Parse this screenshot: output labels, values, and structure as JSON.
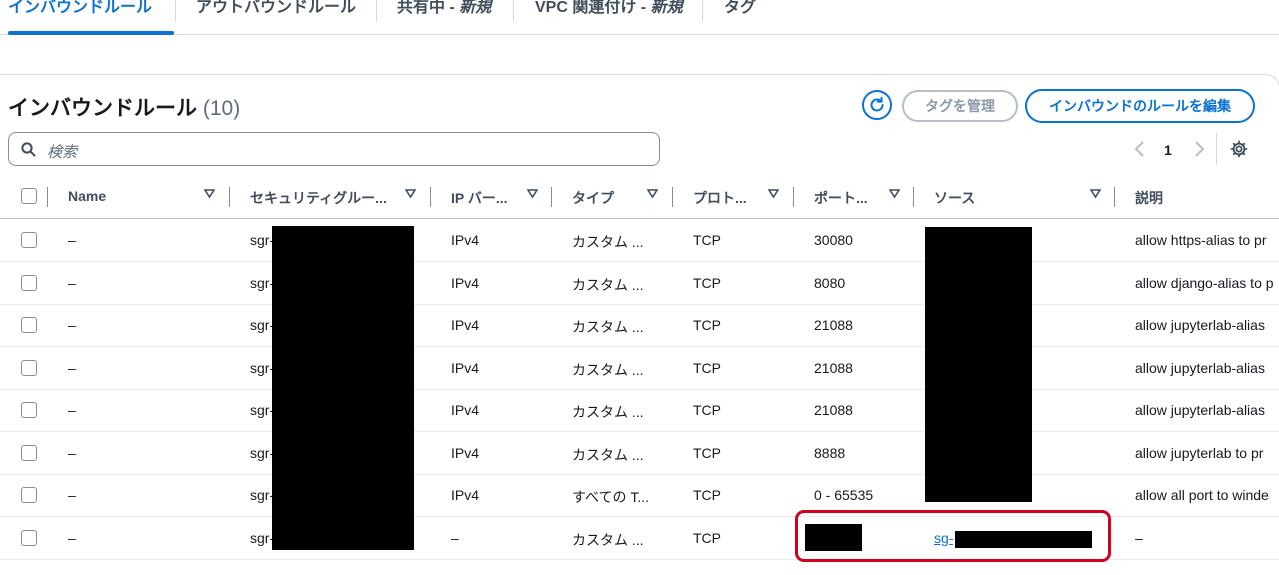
{
  "tabs": [
    {
      "label": "インバウンドルール",
      "active": true
    },
    {
      "label": "アウトバウンドルール",
      "active": false
    },
    {
      "label_prefix": "共有中 - ",
      "label_em": "新規",
      "active": false
    },
    {
      "label_prefix": "VPC 関連付け - ",
      "label_em": "新規",
      "active": false
    },
    {
      "label": "タグ",
      "active": false
    }
  ],
  "header": {
    "title": "インバウンドルール",
    "count": "(10)",
    "manage_tags_label": "タグを管理",
    "edit_rules_label": "インバウンドのルールを編集"
  },
  "search": {
    "placeholder": "検索"
  },
  "pagination": {
    "current_page": "1"
  },
  "columns": [
    "Name",
    "セキュリティグルー...",
    "IP バー...",
    "タイプ",
    "プロト...",
    "ポート...",
    "ソース",
    "説明"
  ],
  "rows": [
    {
      "name": "–",
      "sgr": "sgr-",
      "ip": "IPv4",
      "type": "カスタム ...",
      "proto": "TCP",
      "port": "30080",
      "desc": "allow https-alias to pr"
    },
    {
      "name": "–",
      "sgr": "sgr-",
      "ip": "IPv4",
      "type": "カスタム ...",
      "proto": "TCP",
      "port": "8080",
      "desc": "allow django-alias to p"
    },
    {
      "name": "–",
      "sgr": "sgr-",
      "ip": "IPv4",
      "type": "カスタム ...",
      "proto": "TCP",
      "port": "21088",
      "desc": "allow jupyterlab-alias"
    },
    {
      "name": "–",
      "sgr": "sgr-",
      "ip": "IPv4",
      "type": "カスタム ...",
      "proto": "TCP",
      "port": "21088",
      "desc": "allow jupyterlab-alias"
    },
    {
      "name": "–",
      "sgr": "sgr-",
      "ip": "IPv4",
      "type": "カスタム ...",
      "proto": "TCP",
      "port": "21088",
      "desc": "allow jupyterlab-alias"
    },
    {
      "name": "–",
      "sgr": "sgr-",
      "ip": "IPv4",
      "type": "カスタム ...",
      "proto": "TCP",
      "port": "8888",
      "desc": "allow jupyterlab to pr"
    },
    {
      "name": "–",
      "sgr": "sgr-",
      "ip": "IPv4",
      "type": "すべての T...",
      "proto": "TCP",
      "port": "0 - 65535",
      "desc": "allow all port to winde"
    },
    {
      "name": "–",
      "sgr": "sgr-",
      "ip": "–",
      "type": "カスタム ...",
      "proto": "TCP",
      "port": "",
      "source_link": "sg-",
      "desc": "–"
    }
  ],
  "colors": {
    "accent": "#0972d3",
    "highlight_box": "#d0021b",
    "redaction": "#000000"
  }
}
